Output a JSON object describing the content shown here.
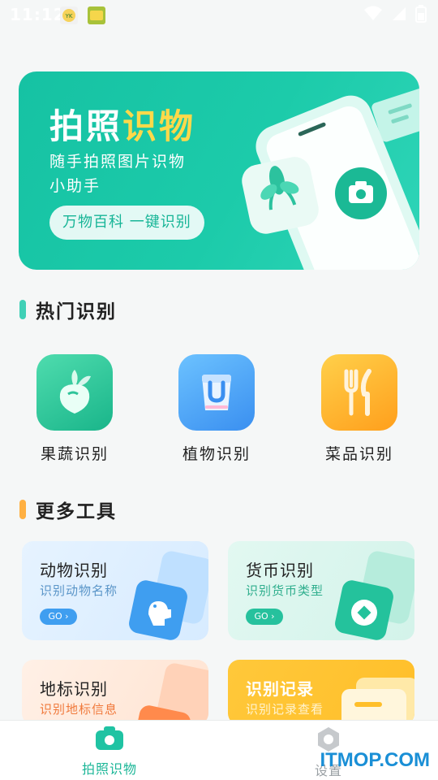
{
  "status_bar": {
    "time": "11:12",
    "app_icon_1": "YK",
    "app_icon_2": "mini"
  },
  "banner": {
    "title_part1": "拍照",
    "title_part2": "识物",
    "subtitle_line1": "随手拍照图片识物",
    "subtitle_line2": "小助手",
    "pill": "万物百科 一键识别",
    "colors": {
      "bg": "#1cc9a9",
      "highlight": "#ffd94a"
    }
  },
  "hot_section": {
    "title": "热门识别",
    "accent": "#3fd0b6",
    "items": [
      {
        "label": "果蔬识别",
        "icon": "turnip-icon",
        "color": "#2ecc9e"
      },
      {
        "label": "植物识别",
        "icon": "plant-bag-icon",
        "color": "#4aa6f5"
      },
      {
        "label": "菜品识别",
        "icon": "fork-knife-icon",
        "color": "#fbb130"
      }
    ]
  },
  "more_section": {
    "title": "更多工具",
    "accent": "#ffb042",
    "tools": [
      {
        "title": "动物识别",
        "subtitle": "识别动物名称",
        "go": "GO",
        "icon": "dog-icon"
      },
      {
        "title": "货币识别",
        "subtitle": "识别货币类型",
        "go": "GO",
        "icon": "coin-icon"
      },
      {
        "title": "地标识别",
        "subtitle": "识别地标信息",
        "icon": "landmark-icon"
      },
      {
        "title": "识别记录",
        "subtitle": "识别记录查看",
        "icon": "record-icon"
      }
    ]
  },
  "tabbar": {
    "tabs": [
      {
        "label": "拍照识物",
        "icon": "camera-icon",
        "active": true
      },
      {
        "label": "设置",
        "icon": "settings-icon",
        "active": false
      }
    ]
  },
  "watermark": "ITMOP.COM"
}
